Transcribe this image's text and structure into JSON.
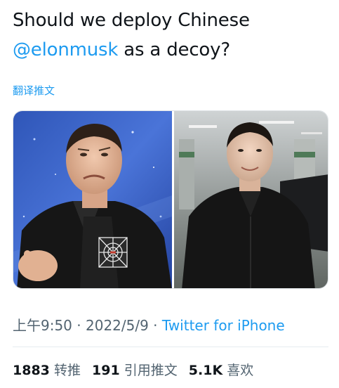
{
  "tweet": {
    "text_before": "Should we deploy Chinese",
    "mention": "@elonmusk",
    "text_after": " as a decoy?"
  },
  "translate_label": "翻译推文",
  "media": {
    "left_photo": "photo-man-black-jacket-space-backdrop",
    "right_photo": "photo-man-black-coat-parking-garage"
  },
  "meta": {
    "time": "上午9:50",
    "separator1": " · ",
    "date": "2022/5/9",
    "separator2": " · ",
    "source": "Twitter for iPhone"
  },
  "stats": {
    "retweets_count": "1883",
    "retweets_label": "转推",
    "quotes_count": "191",
    "quotes_label": "引用推文",
    "likes_count": "5.1K",
    "likes_label": "喜欢"
  },
  "colors": {
    "accent": "#1d9bf0",
    "text": "#0f1419",
    "secondary": "#536471"
  }
}
